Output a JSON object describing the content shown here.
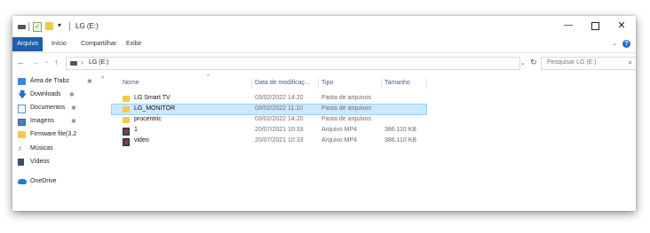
{
  "window": {
    "title": "LG (E:)",
    "quick_access_dropdown": "▾",
    "controls": {
      "minimize": "—",
      "close": "✕"
    }
  },
  "ribbon": {
    "tabs": [
      {
        "label": "Arquivo",
        "active": true
      },
      {
        "label": "Início"
      },
      {
        "label": "Compartilhar"
      },
      {
        "label": "Exibir"
      }
    ],
    "expand_chevron": "⌄",
    "help": "?",
    "accent": "#1f5fad"
  },
  "address": {
    "back": "←",
    "forward": "→",
    "recent": "⌄",
    "up": "↑",
    "separator": "›",
    "path": "LG (E:)",
    "dropdown": "⌄",
    "refresh": "↻",
    "search_placeholder": "Pesquisar LG (E:)",
    "search_icon_glyph": "⌕"
  },
  "navpane": {
    "scroll_up": "^",
    "pin_glyph": "✱",
    "items": [
      {
        "label": "Área de Trabz",
        "icon": "desktop-icon",
        "pinned": true
      },
      {
        "label": "Downloads",
        "icon": "download-icon",
        "pinned": true
      },
      {
        "label": "Documentos",
        "icon": "document-icon",
        "pinned": true
      },
      {
        "label": "Imagens",
        "icon": "pictures-icon",
        "pinned": true
      },
      {
        "label": "Firmware file(3.2",
        "icon": "folder-icon",
        "pinned": false
      },
      {
        "label": "Músicas",
        "icon": "music-icon",
        "pinned": false
      },
      {
        "label": "Vídeos",
        "icon": "video-icon",
        "pinned": false
      },
      {
        "label": "OneDrive",
        "icon": "onedrive-icon",
        "pinned": false
      }
    ]
  },
  "filelist": {
    "columns": {
      "name": "Nome",
      "date": "Data de modificaç...",
      "type": "Tipo",
      "size": "Tamanho"
    },
    "sort_indicator": "^",
    "rows": [
      {
        "name": "LG Smart TV",
        "date": "03/02/2022 14:20",
        "type": "Pasta de arquivos",
        "size": "",
        "icon": "folder-icon",
        "selected": false
      },
      {
        "name": "LG_MONITOR",
        "date": "03/02/2022 11:10",
        "type": "Pasta de arquivos",
        "size": "",
        "icon": "folder-icon",
        "selected": true
      },
      {
        "name": "procentric",
        "date": "03/02/2022 14:20",
        "type": "Pasta de arquivos",
        "size": "",
        "icon": "folder-icon",
        "selected": false
      },
      {
        "name": "1",
        "date": "20/07/2021 10:33",
        "type": "Arquivo MP4",
        "size": "386.110 KB",
        "icon": "video-file-icon",
        "selected": false
      },
      {
        "name": "video",
        "date": "20/07/2021 10:33",
        "type": "Arquivo MP4",
        "size": "386.110 KB",
        "icon": "video-file-icon",
        "selected": false
      }
    ],
    "selection_color": "#cce8ff"
  }
}
